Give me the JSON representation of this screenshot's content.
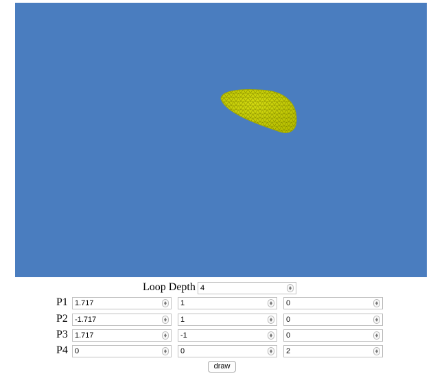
{
  "colors": {
    "canvas_bg": "#4a7dbf",
    "mesh_fill": "#c6cf00",
    "mesh_line": "#7d8200"
  },
  "controls": {
    "loop_depth_label": "Loop Depth",
    "loop_depth_value": "4",
    "points": [
      {
        "label": "P1",
        "values": [
          "1.717",
          "1",
          "0"
        ]
      },
      {
        "label": "P2",
        "values": [
          "-1.717",
          "1",
          "0"
        ]
      },
      {
        "label": "P3",
        "values": [
          "1.717",
          "-1",
          "0"
        ]
      },
      {
        "label": "P4",
        "values": [
          "0",
          "0",
          "2"
        ]
      }
    ],
    "draw_label": "draw"
  }
}
